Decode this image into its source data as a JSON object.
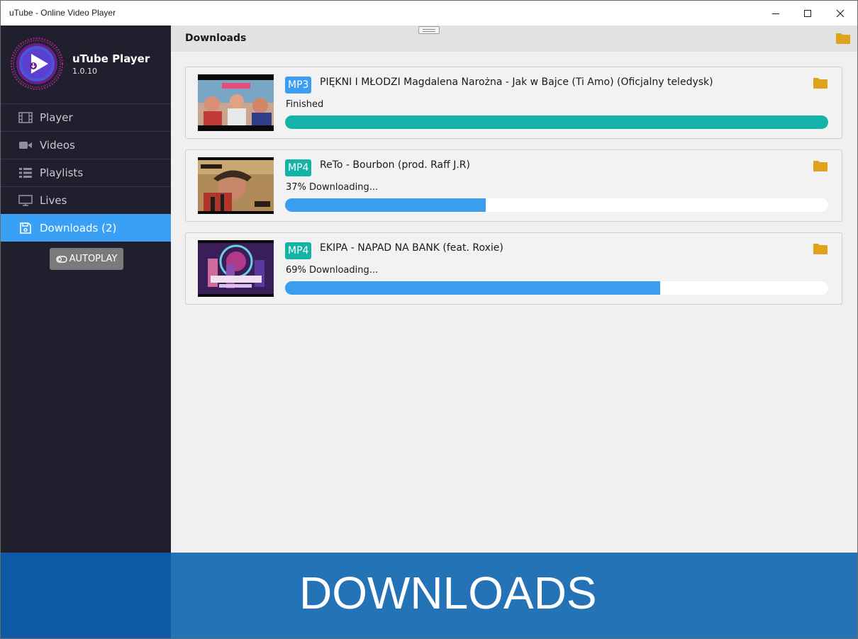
{
  "window": {
    "title": "uTube - Online Video Player"
  },
  "brand": {
    "name": "uTube Player",
    "version": "1.0.10"
  },
  "sidebar": {
    "items": [
      {
        "label": "Player",
        "icon": "film-icon"
      },
      {
        "label": "Videos",
        "icon": "video-camera-icon"
      },
      {
        "label": "Playlists",
        "icon": "list-icon"
      },
      {
        "label": "Lives",
        "icon": "monitor-icon"
      },
      {
        "label": "Downloads (2)",
        "icon": "save-icon",
        "active": true
      }
    ],
    "autoplay_label": "AUTOPLAY"
  },
  "main": {
    "heading": "Downloads",
    "downloads": [
      {
        "format": "MP3",
        "format_color": "#3a9df0",
        "title": "PIĘKNI I MŁODZI Magdalena Narożna - Jak w Bajce (Ti Amo) (Oficjalny teledysk)",
        "status": "Finished",
        "progress": 1.0,
        "bar_color": "#14b3a8"
      },
      {
        "format": "MP4",
        "format_color": "#14b3a8",
        "title": "ReTo - Bourbon (prod. Raff J.R)",
        "status": "37% Downloading...",
        "progress": 0.37,
        "bar_color": "#3a9df0"
      },
      {
        "format": "MP4",
        "format_color": "#14b3a8",
        "title": "EKIPA - NAPAD NA BANK (feat. Roxie)",
        "status": "69% Downloading...",
        "progress": 0.69,
        "bar_color": "#3a9df0"
      }
    ]
  },
  "banner": {
    "text": "DOWNLOADS"
  },
  "colors": {
    "sidebar_bg": "#1f1f2e",
    "active": "#3aa0f5",
    "folder": "#e0a21a",
    "banner": "#2473b7"
  }
}
